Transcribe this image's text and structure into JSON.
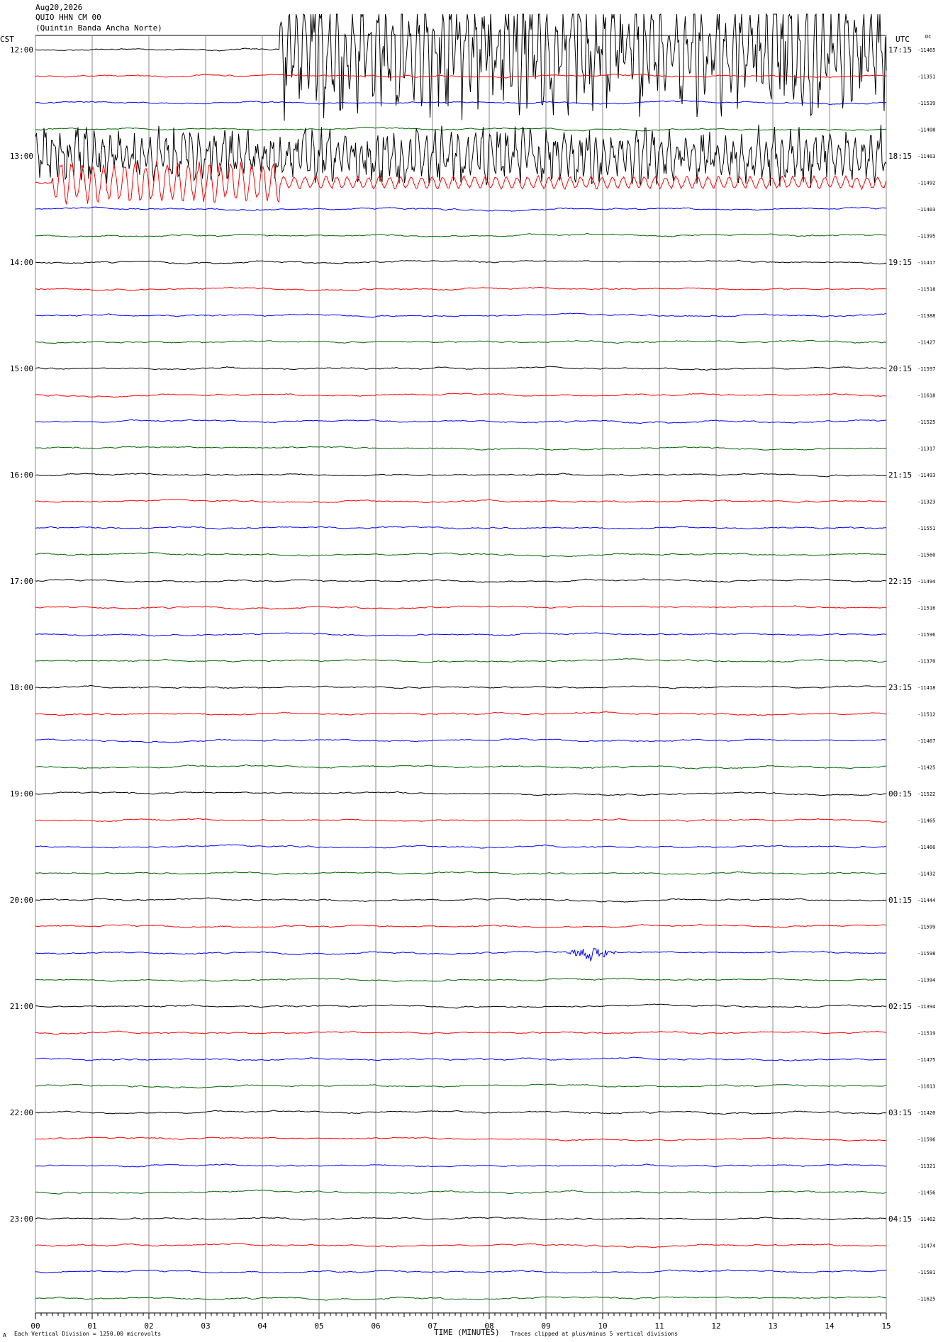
{
  "header": {
    "date": "Aug20,2026",
    "station": "QUIO HHN CM 00",
    "location": "(Quintin Banda Ancha Norte)",
    "left_zone": "CST",
    "right_zone": "UTC",
    "dc_label": "DC"
  },
  "footer": {
    "mark": "A",
    "scale_note": "Each Vertical Division = 1250.00 microvolts",
    "xlabel": "TIME (MINUTES)",
    "clip_note": "Traces clipped at plus/minus 5 vertical divisions"
  },
  "chart_data": {
    "type": "line",
    "title": "",
    "xlabel": "TIME (MINUTES)",
    "x_ticks": [
      "00",
      "01",
      "02",
      "03",
      "04",
      "05",
      "06",
      "07",
      "08",
      "09",
      "10",
      "11",
      "12",
      "13",
      "14",
      "15"
    ],
    "xlim": [
      0,
      15
    ],
    "trace_colors": [
      "#000000",
      "#ff0000",
      "#0000ff",
      "#006400"
    ],
    "left_hour_labels": [
      "12:00",
      "13:00",
      "14:00",
      "15:00",
      "16:00",
      "17:00",
      "18:00",
      "19:00",
      "20:00",
      "21:00",
      "22:00",
      "23:00"
    ],
    "right_utc_labels": [
      "17:15",
      "18:15",
      "19:15",
      "20:15",
      "21:15",
      "22:15",
      "23:15",
      "00:15",
      "01:15",
      "02:15",
      "03:15",
      "04:15"
    ],
    "dc_offsets": [
      -11465,
      -11351,
      -11539,
      -11408,
      -11463,
      -11492,
      -11403,
      -11395,
      -11417,
      -11518,
      -11388,
      -11427,
      -11597,
      -11618,
      -11525,
      -11317,
      -11493,
      -11323,
      -11551,
      -11560,
      -11494,
      -11516,
      -11596,
      -11370,
      -11418,
      -11512,
      -11467,
      -11425,
      -11522,
      -11465,
      -11466,
      -11432,
      -11444,
      -11599,
      -11598,
      -11394,
      -11394,
      -11519,
      -11475,
      -11613,
      -11420,
      -11596,
      -11321,
      -11456,
      -11462,
      -11474,
      -11581,
      -11625
    ],
    "events": [
      {
        "trace_index": 0,
        "start_min": 4.3,
        "end_min": 15,
        "amplitude": "clipped"
      },
      {
        "trace_index": 4,
        "start_min": 0.0,
        "end_min": 15,
        "amplitude": "clipped"
      },
      {
        "trace_index": 5,
        "start_min": 0.3,
        "end_min": 15,
        "amplitude": "large"
      },
      {
        "trace_index": 34,
        "start_min": 9.3,
        "end_min": 10.3,
        "amplitude": "small"
      }
    ]
  }
}
